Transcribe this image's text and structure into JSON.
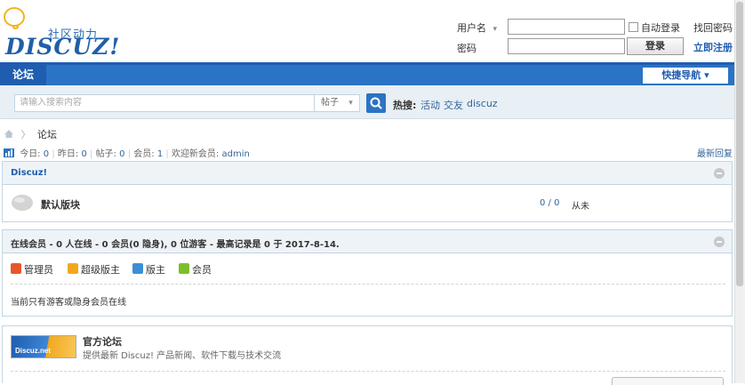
{
  "header": {
    "logo_text": "DISCUZ!",
    "logo_tagline": "社区动力",
    "username_label": "用户名",
    "password_label": "密码",
    "auto_login_label": "自动登录",
    "forgot_password": "找回密码",
    "login_button": "登录",
    "register_link": "立即注册"
  },
  "nav": {
    "forum_tab": "论坛",
    "quick_nav": "快捷导航 ▾"
  },
  "search": {
    "placeholder": "请输入搜索内容",
    "type_value": "帖子",
    "hot_label": "热搜:",
    "hot_terms": [
      "活动",
      "交友",
      "discuz"
    ]
  },
  "breadcrumb": {
    "current": "论坛"
  },
  "stats": {
    "today_label": "今日:",
    "today_value": "0",
    "yesterday_label": "昨日:",
    "yesterday_value": "0",
    "posts_label": "帖子:",
    "posts_value": "0",
    "members_label": "会员:",
    "members_value": "1",
    "welcome_label": "欢迎新会员:",
    "welcome_user": "admin",
    "latest_reply": "最新回复"
  },
  "category": {
    "title": "Discuz!",
    "forum_name": "默认版块",
    "counts": "0 / 0",
    "last_post": "从未"
  },
  "online": {
    "title": "在线会员 - 0 人在线 - 0 会员(0 隐身), 0 位游客 - 最高记录是 0 于 2017-8-14.",
    "legend": [
      {
        "label": "管理员",
        "color": "#e8562a"
      },
      {
        "label": "超级版主",
        "color": "#f2a81d"
      },
      {
        "label": "版主",
        "color": "#3e8ed6"
      },
      {
        "label": "会员",
        "color": "#7cbf2c"
      }
    ],
    "status_text": "当前只有游客或隐身会员在线"
  },
  "partner": {
    "logo_text": "Discuz.net",
    "title": "官方论坛",
    "description": "提供最新 Discuz! 产品新闻、软件下载与技术交流"
  },
  "colors": {
    "nav_blue": "#2b73c4",
    "link": "#336699",
    "box_border": "#c2d5e3"
  }
}
